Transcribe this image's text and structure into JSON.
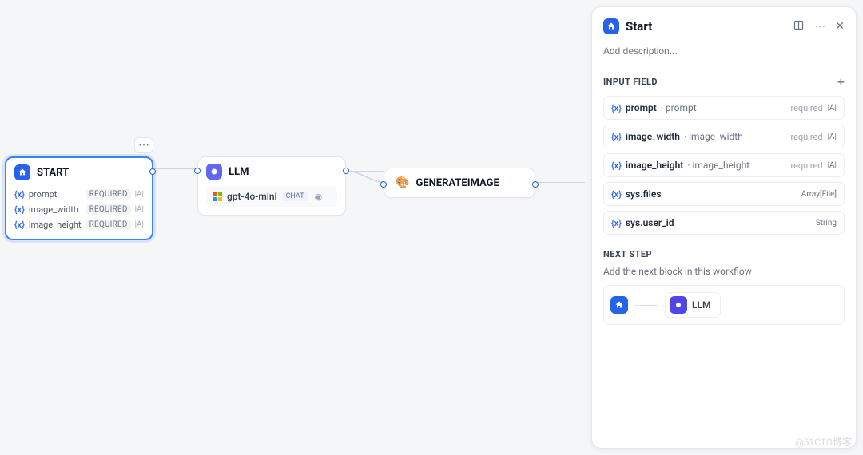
{
  "nodes": {
    "start": {
      "title": "START",
      "fields": [
        {
          "name": "prompt",
          "badge": "REQUIRED",
          "type": "|A|"
        },
        {
          "name": "image_width",
          "badge": "REQUIRED",
          "type": "|A|"
        },
        {
          "name": "image_height",
          "badge": "REQUIRED",
          "type": "|A|"
        }
      ]
    },
    "llm": {
      "title": "LLM",
      "model": "gpt-4o-mini",
      "chat_label": "CHAT"
    },
    "generate": {
      "title": "GENERATEIMAGE"
    }
  },
  "panel": {
    "title": "Start",
    "description_placeholder": "Add description...",
    "sections": {
      "input_field": {
        "title": "INPUT FIELD",
        "rows": [
          {
            "name": "prompt",
            "alias": "prompt",
            "required": "required",
            "type": "|A|"
          },
          {
            "name": "image_width",
            "alias": "image_width",
            "required": "required",
            "type": "|A|"
          },
          {
            "name": "image_height",
            "alias": "image_height",
            "required": "required",
            "type": "|A|"
          },
          {
            "name": "sys.files",
            "alias": "",
            "required": "",
            "type": "Array[File]"
          },
          {
            "name": "sys.user_id",
            "alias": "",
            "required": "",
            "type": "String"
          }
        ]
      },
      "next_step": {
        "title": "NEXT STEP",
        "hint": "Add the next block in this workflow",
        "target": "LLM"
      }
    }
  },
  "watermark": "@51CTO博客"
}
